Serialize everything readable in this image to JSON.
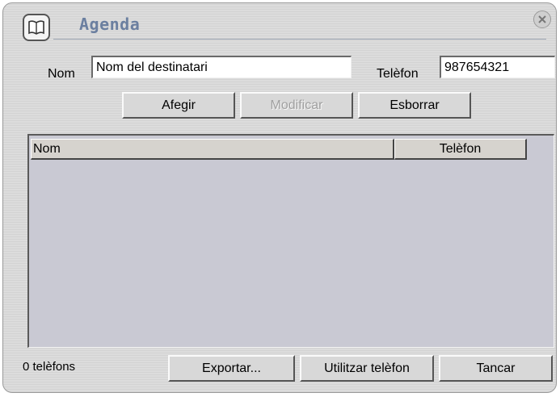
{
  "window": {
    "title": "Agenda"
  },
  "form": {
    "name_label": "Nom",
    "name_value": "Nom del destinatari",
    "phone_label": "Telèfon",
    "phone_value": "987654321"
  },
  "actions": {
    "add_label": "Afegir",
    "modify_label": "Modificar",
    "delete_label": "Esborrar"
  },
  "list": {
    "columns": [
      "Nom",
      "Telèfon"
    ],
    "rows": []
  },
  "footer": {
    "status": "0 telèfons",
    "export_label": "Exportar...",
    "use_phone_label": "Utilitzar telèfon",
    "close_label": "Tancar"
  },
  "icons": {
    "title": "book-icon",
    "close": "close-icon"
  }
}
